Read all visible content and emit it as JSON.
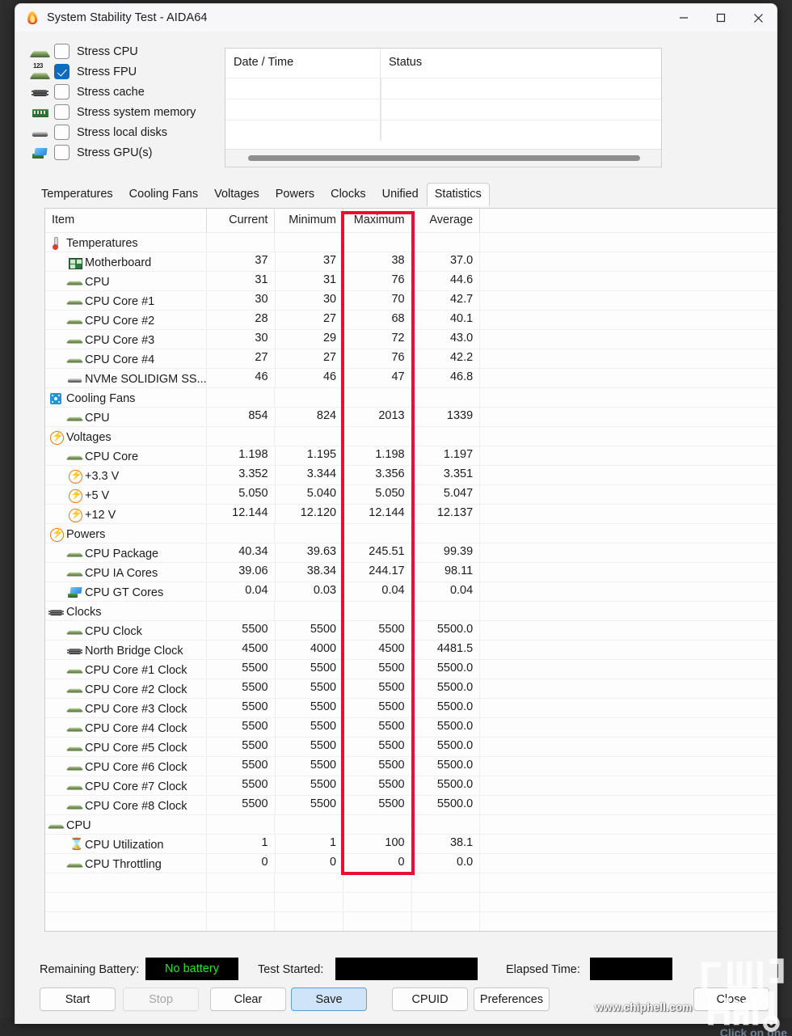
{
  "window": {
    "title": "System Stability Test - AIDA64",
    "icon": "flame-icon",
    "minimize": "—",
    "maximize": "□",
    "close": "✕"
  },
  "stress_options": [
    {
      "label": "Stress CPU",
      "checked": false,
      "icon": "cpu-icon"
    },
    {
      "label": "Stress FPU",
      "checked": true,
      "icon": "fpu-icon"
    },
    {
      "label": "Stress cache",
      "checked": false,
      "icon": "cache-icon"
    },
    {
      "label": "Stress system memory",
      "checked": false,
      "icon": "memory-icon"
    },
    {
      "label": "Stress local disks",
      "checked": false,
      "icon": "disk-icon"
    },
    {
      "label": "Stress GPU(s)",
      "checked": false,
      "icon": "gpu-icon"
    }
  ],
  "log_panel": {
    "columns": [
      "Date / Time",
      "Status"
    ],
    "rows": []
  },
  "tabs": [
    {
      "label": "Temperatures",
      "active": false
    },
    {
      "label": "Cooling Fans",
      "active": false
    },
    {
      "label": "Voltages",
      "active": false
    },
    {
      "label": "Powers",
      "active": false
    },
    {
      "label": "Clocks",
      "active": false
    },
    {
      "label": "Unified",
      "active": false
    },
    {
      "label": "Statistics",
      "active": true
    }
  ],
  "statistics": {
    "columns": [
      "Item",
      "Current",
      "Minimum",
      "Maximum",
      "Average"
    ],
    "highlight_column": "Maximum",
    "highlight_color": "#e8112d",
    "rows": [
      {
        "item": "Temperatures",
        "icon": "thermometer-icon",
        "group": true,
        "current": "",
        "minimum": "",
        "maximum": "",
        "average": ""
      },
      {
        "item": "Motherboard",
        "icon": "motherboard-icon",
        "group": false,
        "current": "37",
        "minimum": "37",
        "maximum": "38",
        "average": "37.0"
      },
      {
        "item": "CPU",
        "icon": "cpu-icon",
        "group": false,
        "current": "31",
        "minimum": "31",
        "maximum": "76",
        "average": "44.6"
      },
      {
        "item": "CPU Core #1",
        "icon": "cpu-icon",
        "group": false,
        "current": "30",
        "minimum": "30",
        "maximum": "70",
        "average": "42.7"
      },
      {
        "item": "CPU Core #2",
        "icon": "cpu-icon",
        "group": false,
        "current": "28",
        "minimum": "27",
        "maximum": "68",
        "average": "40.1"
      },
      {
        "item": "CPU Core #3",
        "icon": "cpu-icon",
        "group": false,
        "current": "30",
        "minimum": "29",
        "maximum": "72",
        "average": "43.0"
      },
      {
        "item": "CPU Core #4",
        "icon": "cpu-icon",
        "group": false,
        "current": "27",
        "minimum": "27",
        "maximum": "76",
        "average": "42.2"
      },
      {
        "item": "NVMe SOLIDIGM SS...",
        "icon": "drive-icon",
        "group": false,
        "current": "46",
        "minimum": "46",
        "maximum": "47",
        "average": "46.8"
      },
      {
        "item": "Cooling Fans",
        "icon": "fan-icon",
        "group": true,
        "current": "",
        "minimum": "",
        "maximum": "",
        "average": ""
      },
      {
        "item": "CPU",
        "icon": "cpu-icon",
        "group": false,
        "current": "854",
        "minimum": "824",
        "maximum": "2013",
        "average": "1339"
      },
      {
        "item": "Voltages",
        "icon": "voltage-icon",
        "group": true,
        "current": "",
        "minimum": "",
        "maximum": "",
        "average": ""
      },
      {
        "item": "CPU Core",
        "icon": "cpu-icon",
        "group": false,
        "current": "1.198",
        "minimum": "1.195",
        "maximum": "1.198",
        "average": "1.197"
      },
      {
        "item": "+3.3 V",
        "icon": "voltage-icon",
        "group": false,
        "current": "3.352",
        "minimum": "3.344",
        "maximum": "3.356",
        "average": "3.351"
      },
      {
        "item": "+5 V",
        "icon": "voltage-icon",
        "group": false,
        "current": "5.050",
        "minimum": "5.040",
        "maximum": "5.050",
        "average": "5.047"
      },
      {
        "item": "+12 V",
        "icon": "voltage-icon",
        "group": false,
        "current": "12.144",
        "minimum": "12.120",
        "maximum": "12.144",
        "average": "12.137"
      },
      {
        "item": "Powers",
        "icon": "voltage-icon",
        "group": true,
        "current": "",
        "minimum": "",
        "maximum": "",
        "average": ""
      },
      {
        "item": "CPU Package",
        "icon": "cpu-icon",
        "group": false,
        "current": "40.34",
        "minimum": "39.63",
        "maximum": "245.51",
        "average": "99.39"
      },
      {
        "item": "CPU IA Cores",
        "icon": "cpu-icon",
        "group": false,
        "current": "39.06",
        "minimum": "38.34",
        "maximum": "244.17",
        "average": "98.11"
      },
      {
        "item": "CPU GT Cores",
        "icon": "gpu-icon",
        "group": false,
        "current": "0.04",
        "minimum": "0.03",
        "maximum": "0.04",
        "average": "0.04"
      },
      {
        "item": "Clocks",
        "icon": "northbridge-icon",
        "group": true,
        "current": "",
        "minimum": "",
        "maximum": "",
        "average": ""
      },
      {
        "item": "CPU Clock",
        "icon": "cpu-icon",
        "group": false,
        "current": "5500",
        "minimum": "5500",
        "maximum": "5500",
        "average": "5500.0"
      },
      {
        "item": "North Bridge Clock",
        "icon": "northbridge-icon",
        "group": false,
        "current": "4500",
        "minimum": "4000",
        "maximum": "4500",
        "average": "4481.5"
      },
      {
        "item": "CPU Core #1 Clock",
        "icon": "cpu-icon",
        "group": false,
        "current": "5500",
        "minimum": "5500",
        "maximum": "5500",
        "average": "5500.0"
      },
      {
        "item": "CPU Core #2 Clock",
        "icon": "cpu-icon",
        "group": false,
        "current": "5500",
        "minimum": "5500",
        "maximum": "5500",
        "average": "5500.0"
      },
      {
        "item": "CPU Core #3 Clock",
        "icon": "cpu-icon",
        "group": false,
        "current": "5500",
        "minimum": "5500",
        "maximum": "5500",
        "average": "5500.0"
      },
      {
        "item": "CPU Core #4 Clock",
        "icon": "cpu-icon",
        "group": false,
        "current": "5500",
        "minimum": "5500",
        "maximum": "5500",
        "average": "5500.0"
      },
      {
        "item": "CPU Core #5 Clock",
        "icon": "cpu-icon",
        "group": false,
        "current": "5500",
        "minimum": "5500",
        "maximum": "5500",
        "average": "5500.0"
      },
      {
        "item": "CPU Core #6 Clock",
        "icon": "cpu-icon",
        "group": false,
        "current": "5500",
        "minimum": "5500",
        "maximum": "5500",
        "average": "5500.0"
      },
      {
        "item": "CPU Core #7 Clock",
        "icon": "cpu-icon",
        "group": false,
        "current": "5500",
        "minimum": "5500",
        "maximum": "5500",
        "average": "5500.0"
      },
      {
        "item": "CPU Core #8 Clock",
        "icon": "cpu-icon",
        "group": false,
        "current": "5500",
        "minimum": "5500",
        "maximum": "5500",
        "average": "5500.0"
      },
      {
        "item": "CPU",
        "icon": "cpu-icon",
        "group": true,
        "current": "",
        "minimum": "",
        "maximum": "",
        "average": ""
      },
      {
        "item": "CPU Utilization",
        "icon": "hourglass-icon",
        "group": false,
        "current": "1",
        "minimum": "1",
        "maximum": "100",
        "average": "38.1"
      },
      {
        "item": "CPU Throttling",
        "icon": "cpu-icon",
        "group": false,
        "current": "0",
        "minimum": "0",
        "maximum": "0",
        "average": "0.0"
      }
    ]
  },
  "footer": {
    "battery_label": "Remaining Battery:",
    "battery_value": "No battery",
    "battery_value_color": "#2fe02f",
    "test_started_label": "Test Started:",
    "test_started_value": "",
    "elapsed_label": "Elapsed Time:",
    "elapsed_value": "",
    "buttons": [
      {
        "label": "Start",
        "state": "normal"
      },
      {
        "label": "Stop",
        "state": "disabled"
      },
      {
        "label": "Clear",
        "state": "normal"
      },
      {
        "label": "Save",
        "state": "primary"
      },
      {
        "label": "CPUID",
        "state": "normal"
      },
      {
        "label": "Preferences",
        "state": "normal"
      },
      {
        "label": "Close",
        "state": "normal"
      }
    ]
  },
  "watermark": {
    "url": "www.chiphell.com",
    "logo": "chiphell-logo"
  },
  "desktop": {
    "hint": "Click on one"
  }
}
